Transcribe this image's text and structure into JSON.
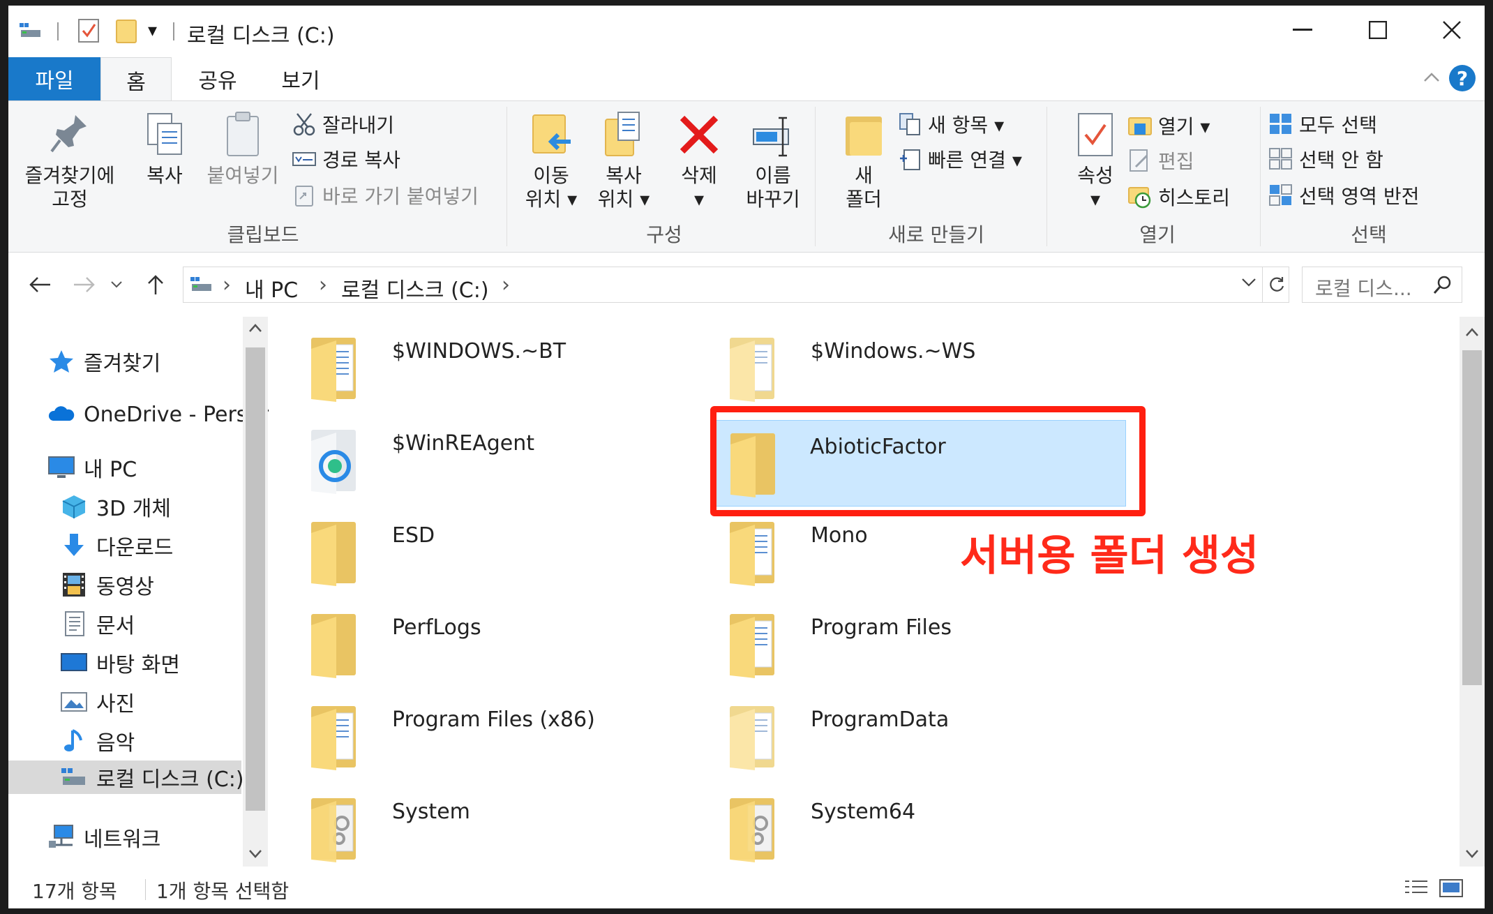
{
  "titlebar": {
    "title": "로컬 디스크 (C:)",
    "qat_dropdown": "▾",
    "minimize": "—",
    "maximize": "☐",
    "close": "✕"
  },
  "tabs": [
    {
      "label": "파일"
    },
    {
      "label": "홈"
    },
    {
      "label": "공유"
    },
    {
      "label": "보기"
    }
  ],
  "ribbon": {
    "clipboard": {
      "pin": "즐겨찾기에\n고정",
      "copy": "복사",
      "paste": "붙여넣기",
      "cut": "잘라내기",
      "copy_path": "경로 복사",
      "paste_shortcut": "바로 가기 붙여넣기",
      "label": "클립보드"
    },
    "organize": {
      "move_to": "이동\n위치 ▾",
      "copy_to": "복사\n위치 ▾",
      "delete": "삭제\n▾",
      "rename": "이름\n바꾸기",
      "label": "구성"
    },
    "new": {
      "new_folder": "새\n폴더",
      "new_item": "새 항목 ▾",
      "easy_access": "빠른 연결 ▾",
      "label": "새로 만들기"
    },
    "open": {
      "properties": "속성\n▾",
      "open": "열기 ▾",
      "edit": "편집",
      "history": "히스토리",
      "label": "열기"
    },
    "select": {
      "select_all": "모두 선택",
      "select_none": "선택 안 함",
      "invert": "선택 영역 반전",
      "label": "선택"
    }
  },
  "address": {
    "crumbs": [
      "내 PC",
      "로컬 디스크 (C:)"
    ],
    "search_placeholder": "로컬 디스...",
    "sep": "›"
  },
  "navpane": {
    "items": [
      {
        "label": "즐겨찾기",
        "icon": "star-icon"
      },
      {
        "label": "OneDrive - Persor",
        "icon": "cloud-icon"
      },
      {
        "label": "내 PC",
        "icon": "computer-icon"
      },
      {
        "label": "3D 개체",
        "icon": "cube-icon"
      },
      {
        "label": "다운로드",
        "icon": "download-icon"
      },
      {
        "label": "동영상",
        "icon": "film-icon"
      },
      {
        "label": "문서",
        "icon": "document-icon"
      },
      {
        "label": "바탕 화면",
        "icon": "desktop-icon"
      },
      {
        "label": "사진",
        "icon": "picture-icon"
      },
      {
        "label": "음악",
        "icon": "music-icon"
      },
      {
        "label": "로컬 디스크 (C:)",
        "icon": "drive-icon"
      },
      {
        "label": "네트워크",
        "icon": "network-icon"
      }
    ]
  },
  "files": [
    {
      "name": "$WINDOWS.~BT"
    },
    {
      "name": "$Windows.~WS"
    },
    {
      "name": "$WinREAgent"
    },
    {
      "name": "AbioticFactor"
    },
    {
      "name": "ESD"
    },
    {
      "name": "Mono"
    },
    {
      "name": "PerfLogs"
    },
    {
      "name": "Program Files"
    },
    {
      "name": "Program Files (x86)"
    },
    {
      "name": "ProgramData"
    },
    {
      "name": "System"
    },
    {
      "name": "System64"
    }
  ],
  "annotation": "서버용 폴더 생성",
  "status": {
    "count": "17개 항목",
    "selected": "1개 항목 선택함"
  },
  "colors": {
    "accent": "#1979ca",
    "highlight": "#ff1f10",
    "selection": "#cce8ff"
  }
}
